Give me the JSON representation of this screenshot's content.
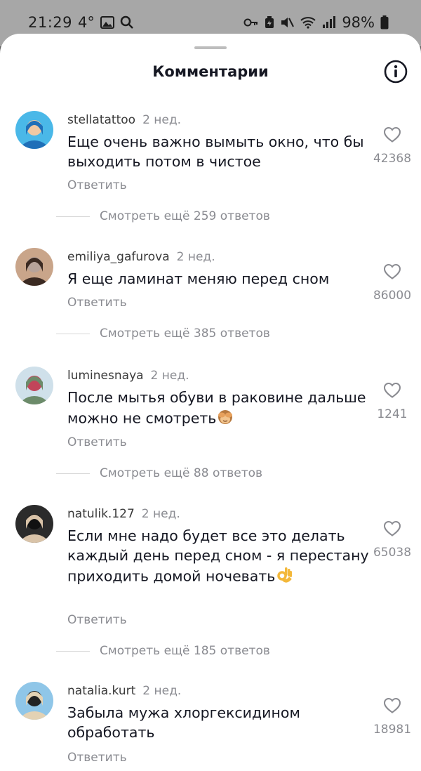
{
  "status_bar": {
    "time": "21:29",
    "temperature": "4°",
    "battery": "98%",
    "icons": [
      "gallery-icon",
      "search-icon",
      "key-icon",
      "battery-saver-icon",
      "mute-icon",
      "wifi-icon",
      "signal-icon",
      "battery-icon"
    ]
  },
  "sheet": {
    "title": "Комментарии",
    "info_icon": "info-icon"
  },
  "comments": [
    {
      "username": "stellatattoo",
      "time": "2 нед.",
      "text": "Еще очень важно вымыть окно, что бы выходить потом в чистое",
      "emoji": "",
      "reply_label": "Ответить",
      "likes": "42368",
      "more_replies": "Смотреть ещё 259 ответов",
      "avatar_colors": [
        "#4ab8e8",
        "#1f6fb8",
        "#f1c9a3"
      ]
    },
    {
      "username": "emiliya_gafurova",
      "time": "2 нед.",
      "text": "Я еще ламинат меняю перед сном",
      "emoji": "",
      "reply_label": "Ответить",
      "likes": "86000",
      "more_replies": "Смотреть ещё 385 ответов",
      "avatar_colors": [
        "#c9a58a",
        "#3b2a22",
        "#b7a39a"
      ]
    },
    {
      "username": "luminesnaya",
      "time": "2 нед.",
      "text": "После мытья обуви в раковине дальше можно не смотреть",
      "emoji": "🙈",
      "reply_label": "Ответить",
      "likes": "1241",
      "more_replies": "Смотреть ещё 88 ответов",
      "avatar_colors": [
        "#cfe0ea",
        "#6c8b6a",
        "#c2455a"
      ]
    },
    {
      "username": "natulik.127",
      "time": "2 нед.",
      "text": "Если мне надо будет все это делать каждый день перед сном - я перестану приходить домой ночевать",
      "emoji": "👌",
      "reply_label": "Ответить",
      "likes": "65038",
      "more_replies": "Смотреть ещё 185 ответов",
      "avatar_colors": [
        "#2b2b2b",
        "#d9c3a8",
        "#111111"
      ]
    },
    {
      "username": "natalia.kurt",
      "time": "2 нед.",
      "text": "Забыла мужа хлоргексидином обработать",
      "emoji": "",
      "reply_label": "Ответить",
      "likes": "18981",
      "more_replies": "",
      "avatar_colors": [
        "#8fc6e8",
        "#e3d2b4",
        "#222222"
      ]
    }
  ]
}
